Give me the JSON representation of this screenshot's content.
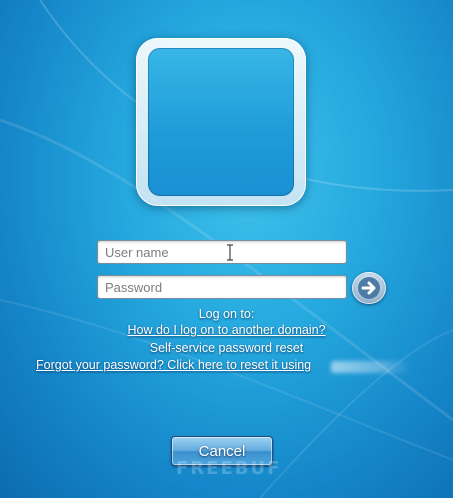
{
  "login": {
    "username_placeholder": "User name",
    "password_placeholder": "Password",
    "submit_icon": "arrow-right-icon",
    "cancel_label": "Cancel"
  },
  "info": {
    "logon_to": "Log on to:",
    "other_domain_link": "How do I log on to another domain?",
    "sspr_text": "Self-service password reset",
    "forgot_link": "Forgot your password? Click here to reset it using"
  },
  "watermark": "FREEBUF",
  "colors": {
    "background_accent": "#1e9bd8",
    "text": "#ffffff"
  }
}
